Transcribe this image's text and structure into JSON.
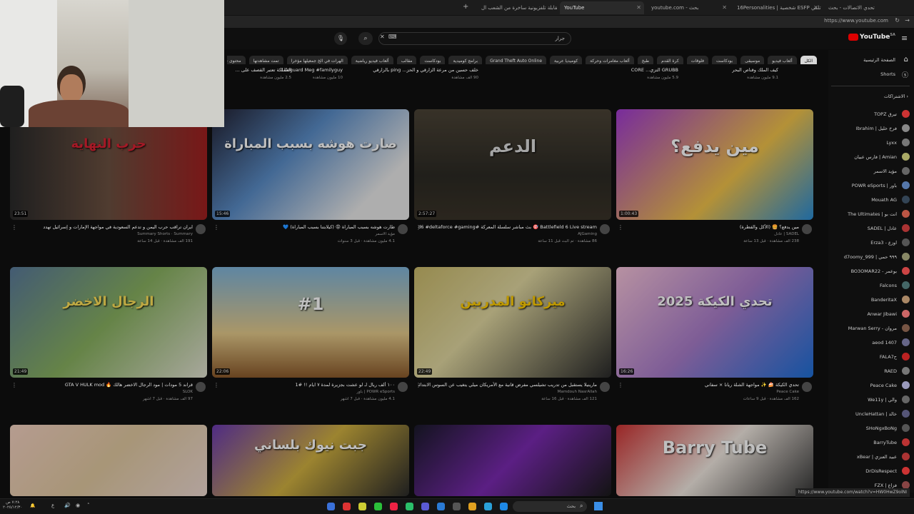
{
  "browser": {
    "tabs": [
      {
        "title": "تحدي الاتصالات - بحث",
        "active": false
      },
      {
        "title": "16Personalities | شخصية ESFP تلقي",
        "active": false
      },
      {
        "title": "youtube.com - بحث",
        "active": false
      },
      {
        "title": "YouTube",
        "active": true
      },
      {
        "title": "مقابلة تلفزيونية ساخرة من الشعب ال...",
        "active": false
      }
    ],
    "url": "https://www.youtube.com"
  },
  "youtube": {
    "logo": "YouTube",
    "logo_sup": "SA",
    "search_value": "جرار",
    "chips": [
      "الكل",
      "ألعاب فيديو",
      "موسيقى",
      "بودكاست",
      "فلوقات",
      "كرة القدم",
      "طبخ",
      "ألعاب مغامرات وحركة",
      "كوميديا عربية",
      "Grand Theft Auto Online",
      "برامج كوميدية",
      "بودكاست",
      "مقالب",
      "ألعاب فيديو رياضية",
      "الهرات في الخ جمعيلها مؤخرا",
      "تمت مشاهدتها",
      "محتوى جديد لك"
    ],
    "sidebar": {
      "home": "الصفحة الرئيسية",
      "shorts": "Shorts",
      "subs_header": "الاشتراكات",
      "channels": [
        "TOPZ تيرق",
        "Ibrahim | فرخ خليل",
        "Lyxx",
        "فارس عبيان | Amian",
        "مؤيد الاسمر",
        "POWR eSports | باور",
        "Mouath AG",
        "The Ultimates | انت بو",
        "SADEL | عادل",
        "Erza3 - اوزع",
        "d7oomy_999 | ٩٩٩ حمي",
        "BO3OMAR22 - بوعمر",
        "Falcons",
        "BanderitaX",
        "Anwar Jibawi",
        "Marwan Serry - مروان",
        "aeod 1407",
        "FALA7ح",
        "RAED",
        "Peace Cake",
        "We11y | والي",
        "UncleHattan | خالد",
        "SHoNgxBoNg",
        "BarryTube",
        "xBear | عبيد العنزي",
        "DrDisRespect",
        "FZX | فزاع"
      ]
    },
    "top_row": [
      {
        "title": "كيف الملك وقناص البحر",
        "meta": "9.1 مليون مشاهدة"
      },
      {
        "title": "GRUBB التزي... CORE",
        "meta": "5.9 مليون مشاهدة"
      },
      {
        "title": "خلف حسين من مرعة الزارقي و الحز... ping بالزارقي #بالقطر #روقنس",
        "meta": "90 ألف مشاهدة"
      },
      {
        "title": "Lifeguard Meg #familyguy",
        "meta": "10 مليون مشاهدة"
      },
      {
        "title": "المملكة تعتبر القصف على ...",
        "meta": "2.5 مليون مشاهدة"
      }
    ],
    "videos": [
      {
        "title": "مين يدفع؟ 🍔 (الأكل والفطرة)",
        "channel": "SADEL | عادل",
        "meta": "238 ألف مشاهدة · قبل 13 ساعة",
        "duration": "1:00:43",
        "overlay": "مين يدفع؟"
      },
      {
        "title": "Battlefield 6 Live stream 🎯 بث مباشر سلسلة المعركة #Battlefield6 #deltaforce #gaming",
        "channel": "AJGaming",
        "meta": "86 مشاهدة · تم البث قبل 11 ساعة",
        "duration": "2:57:27",
        "overlay": "الدعم"
      },
      {
        "title": "طارت هوشه بسبب المباراة 😡 (كيلابتنا بسبب المباراة) 💙",
        "channel": "مؤيد الاسمر",
        "meta": "4.1 مليون مشاهدة · قبل 3 سنوات",
        "duration": "15:46",
        "overlay": "صارت هوشه بسبب المباراة"
      },
      {
        "title": "ايران تراقب حرب اليمن و تدعم السعودية في مواجهة الإمارات و إسرائيل تهدد",
        "channel": "Summary Shorts · Summary",
        "meta": "191 ألف مشاهدة · قبل 14 ساعة",
        "duration": "23:51",
        "overlay": "حرب النهاية"
      },
      {
        "title": "تحدي الكيكة 🍰 ✨ مواجهة الشلة ريانا × سفاني",
        "channel": "Peace Cake",
        "meta": "162 ألف مشاهدة · قبل 9 ساعات",
        "duration": "16:26",
        "overlay": "تحدي الكيكة 2025"
      },
      {
        "title": "مارينيلا يستقبل من تدريب تشيلسي مفرض قانية مع الأمريكان ميلي يتغيب عن السوس الابتدائي في ريال مدريد !",
        "channel": "Mamdouh NasrAllah",
        "meta": "121 ألف مشاهدة · قبل 16 ساعة",
        "duration": "22:49",
        "overlay": "ميركاتو المدربين"
      },
      {
        "title": "١٠٠ ألف ريال لـ لو عشت بجزيرة لمدة ٧ ايام !! #1",
        "channel": "POWR eSports | باور",
        "meta": "4.1 مليون مشاهدة · قبل 7 أشهر",
        "duration": "22:06",
        "overlay": "#1"
      },
      {
        "title": "قراند 5 مودات | مود الرجال الاخضر هالك 🔥 GTA V HULK mod",
        "channel": "SLOK",
        "meta": "97 ألف مشاهدة · قبل 7 أشهر",
        "duration": "21:49",
        "overlay": "الرجال الاخضر"
      },
      {
        "title": "",
        "channel": "",
        "meta": "",
        "duration": "",
        "overlay": "Barry Tube"
      },
      {
        "title": "",
        "channel": "",
        "meta": "",
        "duration": "",
        "overlay": ""
      },
      {
        "title": "",
        "channel": "",
        "meta": "",
        "duration": "",
        "overlay": "جبت نيوك بلساني"
      },
      {
        "title": "",
        "channel": "",
        "meta": "",
        "duration": "",
        "overlay": ""
      }
    ],
    "status_url": "https://www.youtube.com/watch?v=HW0HwZ9olNI"
  },
  "taskbar": {
    "search_label": "بحث",
    "clock_time": "٧:٢٨ ص",
    "clock_date": "٢٠٢٥/١٢/٣٠",
    "lang": "ع"
  },
  "colors": {
    "bg": "#0f0f0f",
    "accent": "#ff0000"
  }
}
